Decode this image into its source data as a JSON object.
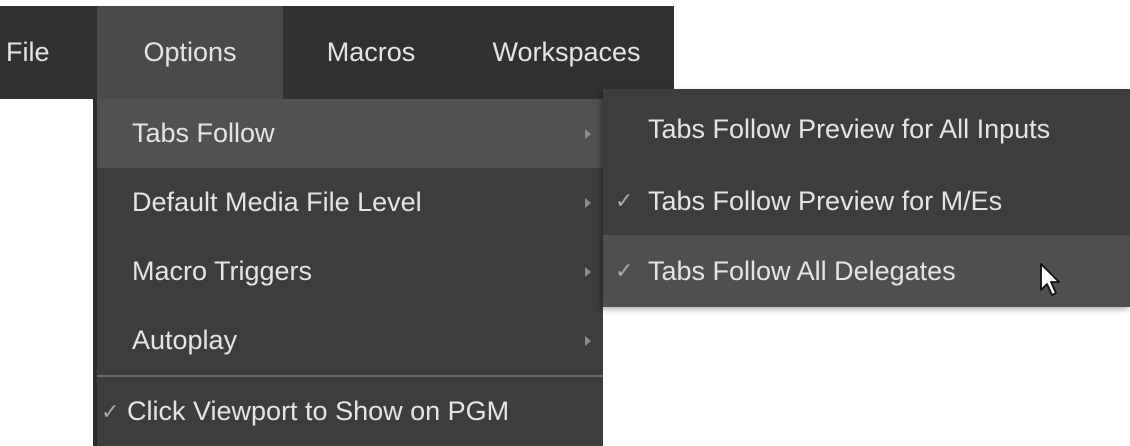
{
  "menubar": {
    "items": [
      {
        "label": "File"
      },
      {
        "label": "Options"
      },
      {
        "label": "Macros"
      },
      {
        "label": "Workspaces"
      }
    ],
    "active": "Options"
  },
  "options_menu": {
    "items": [
      {
        "label": "Tabs Follow",
        "has_submenu": true,
        "hovered": true
      },
      {
        "label": "Default Media File Level",
        "has_submenu": true
      },
      {
        "label": "Macro Triggers",
        "has_submenu": true
      },
      {
        "label": "Autoplay",
        "has_submenu": true
      },
      {
        "label": "Click Viewport to Show on PGM",
        "checked": true,
        "check_glyph": "✓"
      }
    ]
  },
  "tabs_follow_submenu": {
    "items": [
      {
        "label": "Tabs Follow Preview for All Inputs",
        "checked": false
      },
      {
        "label": "Tabs Follow Preview for M/Es",
        "checked": true,
        "check_glyph": "✓"
      },
      {
        "label": "Tabs Follow All Delegates",
        "checked": true,
        "check_glyph": "✓",
        "hovered": true
      }
    ]
  },
  "colors": {
    "menubar_bg": "#313131",
    "menubar_active": "#4a4a4b",
    "menu_bg": "#3d3d3e",
    "menu_hover": "#515152",
    "text": "#e4e4e4"
  },
  "icons": {
    "submenu_arrow": "chevron-right-icon",
    "checkmark": "check-icon",
    "cursor": "mouse-pointer-icon"
  }
}
